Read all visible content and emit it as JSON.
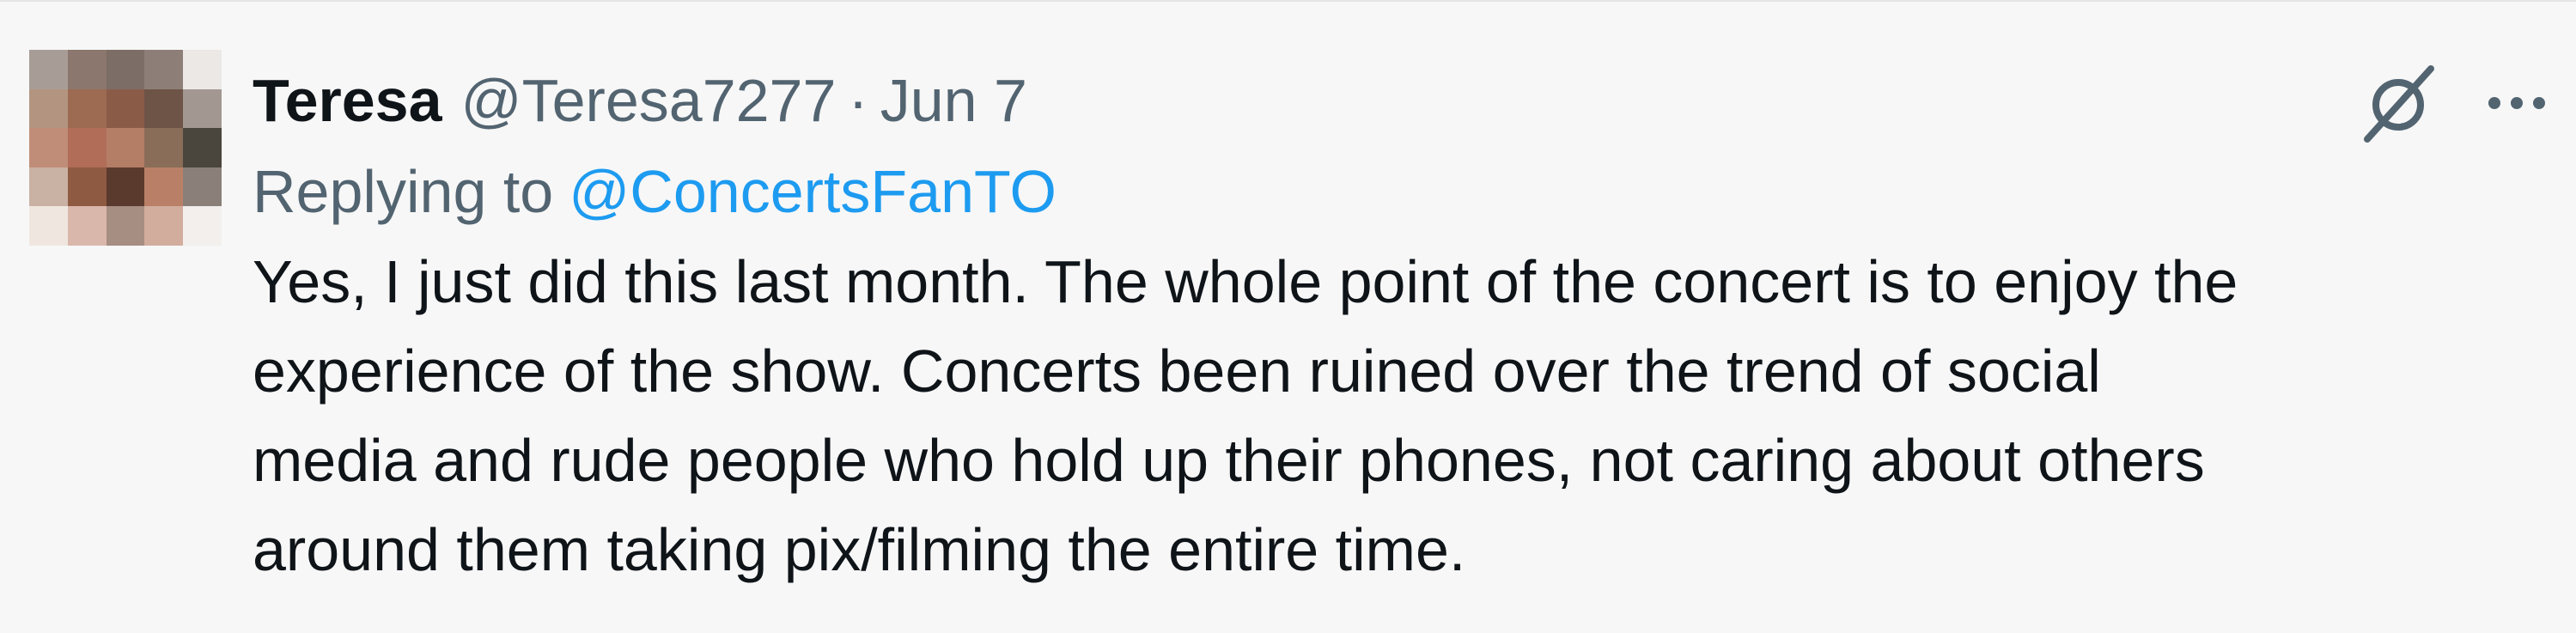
{
  "tweet": {
    "display_name": "Teresa",
    "handle": "@Teresa7277",
    "separator": "·",
    "date": "Jun 7",
    "reply_prefix": "Replying to",
    "reply_to": "@ConcertsFanTO",
    "text": "Yes, I just did this last month. The whole point of the concert is to enjoy the\nexperience of the show. Concerts been ruined over the trend of social\nmedia and rude people who hold up their phones, not caring about others\naround them taking pix/filming the entire time."
  },
  "icons": {
    "grok": "grok-icon",
    "more": "more-icon"
  },
  "colors": {
    "name": "#0f1419",
    "secondary": "#536471",
    "link": "#1d9bf0",
    "background": "#f7f7f7"
  }
}
